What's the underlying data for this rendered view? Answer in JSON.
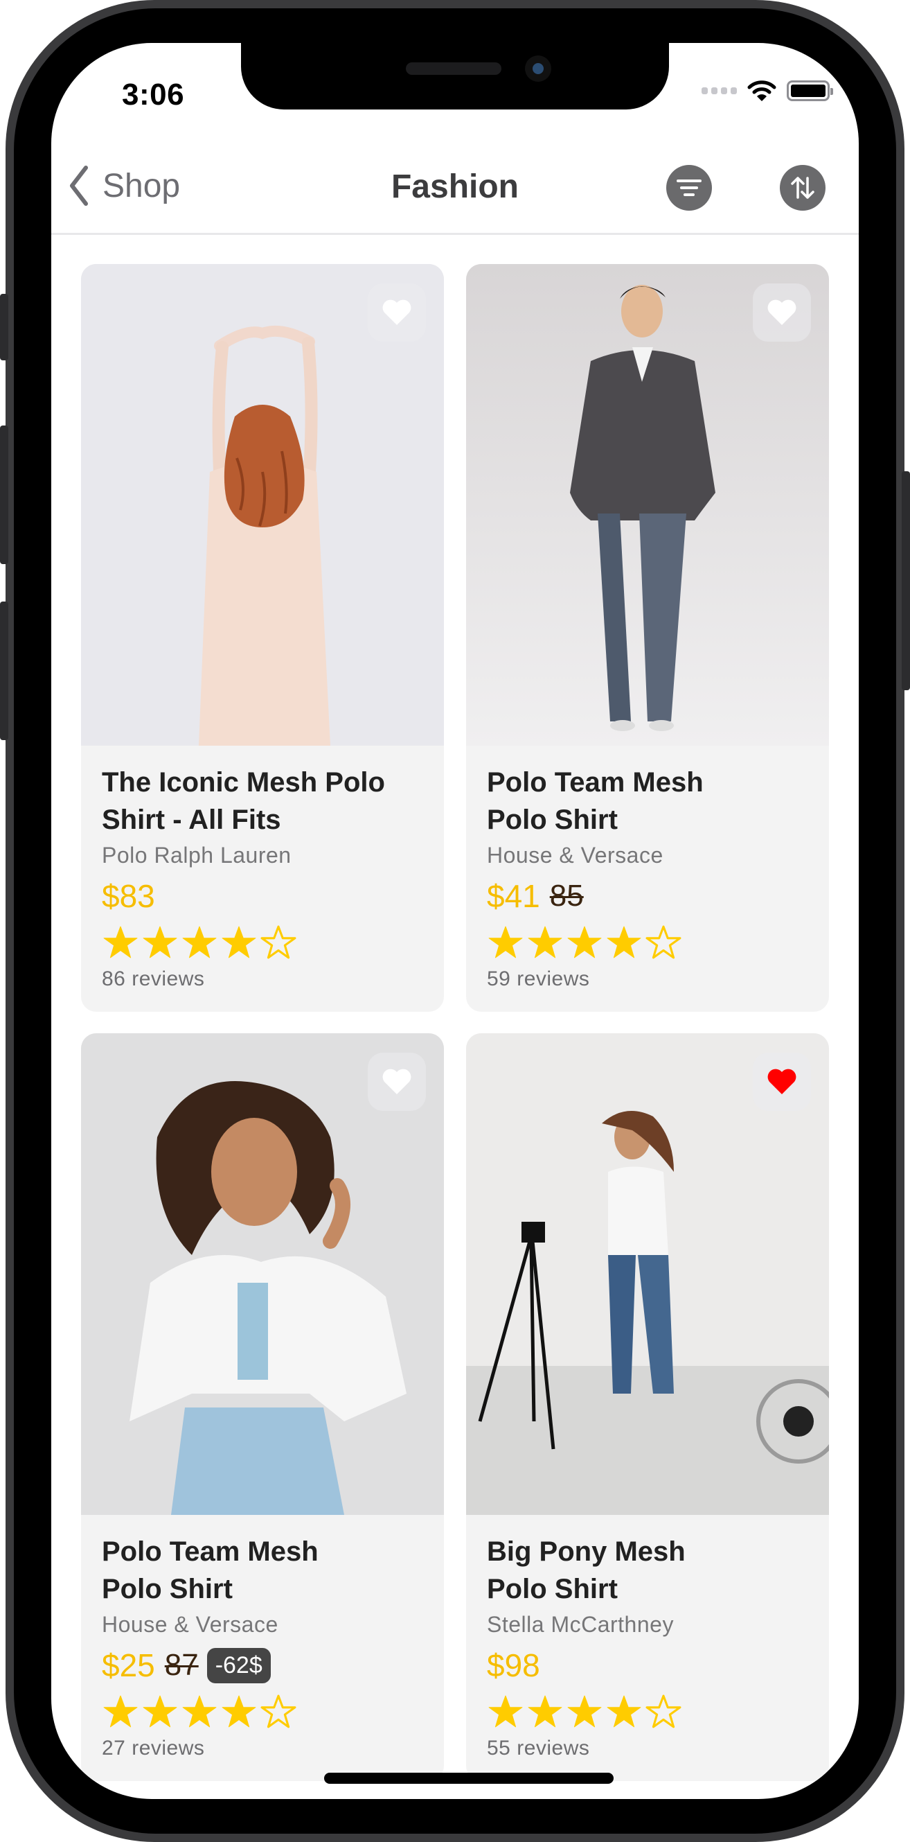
{
  "status_bar": {
    "time": "3:06"
  },
  "navbar": {
    "back_label": "Shop",
    "title": "Fashion",
    "filter_icon": "filter-icon",
    "sort_icon": "sort-arrows-icon"
  },
  "colors": {
    "price": "#f6bd00",
    "star": "#ffcc00",
    "favorite_active": "#ff0000",
    "card_bg": "#f3f3f3",
    "discount_bg": "#454545"
  },
  "products": [
    {
      "title_line1": "The Iconic Mesh Polo",
      "title_line2": "Shirt - All Fits",
      "brand": "Polo Ralph Lauren",
      "price": "$83",
      "old_price": "",
      "discount": "",
      "rating": 4,
      "rating_max": 5,
      "reviews": "86 reviews",
      "favorite": false
    },
    {
      "title_line1": "Polo Team Mesh",
      "title_line2": "Polo Shirt",
      "brand": "House & Versace",
      "price": "$41",
      "old_price": "85",
      "discount": "",
      "rating": 4,
      "rating_max": 5,
      "reviews": "59 reviews",
      "favorite": false
    },
    {
      "title_line1": "Polo Team Mesh",
      "title_line2": "Polo Shirt",
      "brand": "House & Versace",
      "price": "$25",
      "old_price": "87",
      "discount": "-62$",
      "rating": 4,
      "rating_max": 5,
      "reviews": "27 reviews",
      "favorite": false
    },
    {
      "title_line1": "Big Pony Mesh",
      "title_line2": "Polo Shirt",
      "brand": "Stella McCarthney",
      "price": "$98",
      "old_price": "",
      "discount": "",
      "rating": 4,
      "rating_max": 5,
      "reviews": "55 reviews",
      "favorite": true
    }
  ]
}
